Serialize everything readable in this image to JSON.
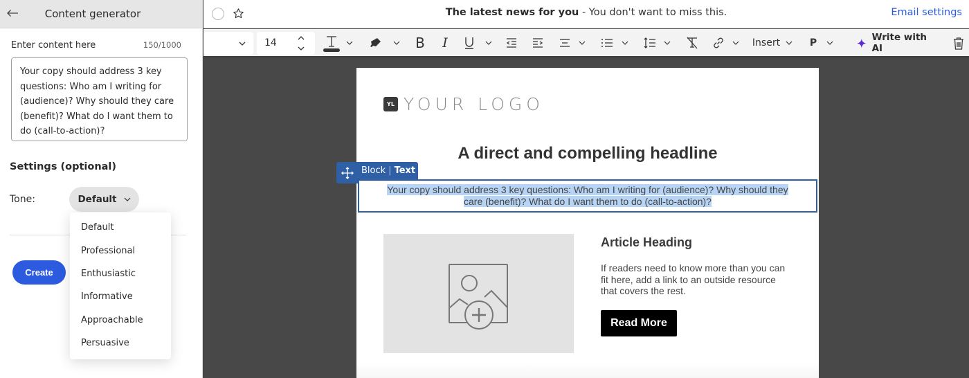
{
  "sidebar": {
    "title": "Content generator",
    "back_icon": "arrow-left-icon",
    "content_label": "Enter content here",
    "char_count": "150/1000",
    "content_value": "Your copy should address 3 key questions: Who am I writing for (audience)? Why should they care (benefit)? What do I want them to do (call-to-action)?",
    "settings_heading": "Settings (optional)",
    "tone_label": "Tone:",
    "tone_selected": "Default",
    "tone_options": [
      "Default",
      "Professional",
      "Enthusiastic",
      "Informative",
      "Approachable",
      "Persuasive"
    ],
    "create_label": "Create"
  },
  "topbar": {
    "subject_bold": "The latest news for you",
    "subject_rest": " - You don't want to miss this.",
    "email_settings_label": "Email settings"
  },
  "toolbar": {
    "font_family": "",
    "font_size": "14",
    "insert_label": "Insert",
    "paragraph_label": "P",
    "write_ai_label": "Write with AI",
    "icons": [
      "chevron-down-icon",
      "stepper-up-icon",
      "stepper-down-icon",
      "text-color-icon",
      "highlighter-icon",
      "bold-icon",
      "italic-icon",
      "underline-icon",
      "outdent-icon",
      "indent-icon",
      "align-center-icon",
      "bullet-list-icon",
      "line-height-icon",
      "clear-format-icon",
      "link-icon",
      "sparkle-icon",
      "trash-icon"
    ]
  },
  "email": {
    "logo_mark": "YL",
    "logo_text": "YOUR LOGO",
    "headline": "A direct and compelling headline",
    "block_tag": {
      "block": "Block",
      "separator": "|",
      "type": "Text"
    },
    "body_text_line1": "Your copy should address 3 key questions: Who am I writing for (audience)? Why should they",
    "body_text_line2": "care (benefit)? What do I want them to do (call-to-action)?",
    "article_heading": "Article Heading",
    "article_body": "If readers need to know more than you can fit here, add a link to an outside resource that covers the rest.",
    "read_more_label": "Read More"
  },
  "colors": {
    "accent_blue": "#2c5be0",
    "block_blue": "#2f5fa5",
    "selection": "#b7d4f5",
    "canvas_bg": "#484848",
    "ai_sparkle": "#5b2bd6"
  }
}
